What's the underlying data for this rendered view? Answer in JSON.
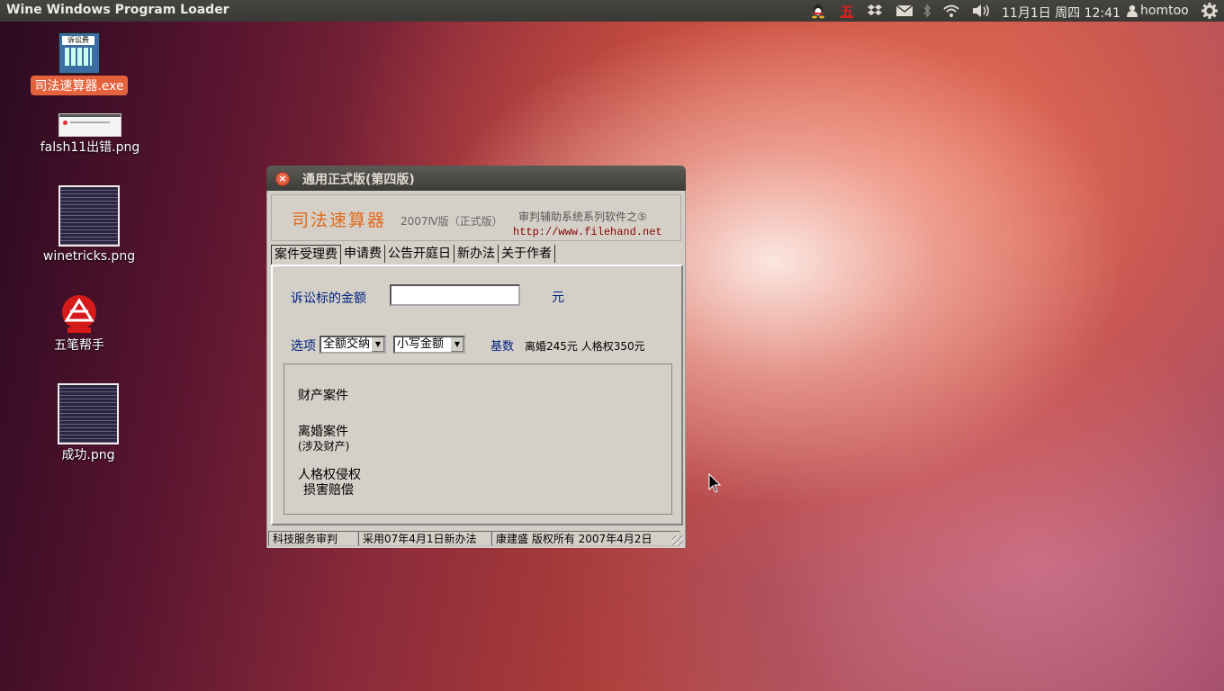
{
  "panel": {
    "app_title": "Wine Windows Program Loader",
    "clock": "11月1日 周四 12:41",
    "user": "homtoo",
    "indicators": [
      "qq-icon",
      "wubi-input-icon",
      "dropbox-icon",
      "mail-icon",
      "bluetooth-icon",
      "wifi-icon",
      "volume-icon"
    ],
    "wubi_glyph": "五"
  },
  "desktop": {
    "icons": [
      {
        "label": "司法速算器.exe",
        "thumb_text": "诉讼费"
      },
      {
        "label": "falsh11出错.png"
      },
      {
        "label": "winetricks.png"
      },
      {
        "label": "五笔帮手"
      },
      {
        "label": "成功.png"
      }
    ]
  },
  "window": {
    "title": "通用正式版(第四版)",
    "close": "×",
    "banner": {
      "logo": "司法速算器",
      "version": "2007Ⅳ版（正式版）",
      "series": "审判辅助系统系列软件之⑤",
      "url": "http://www.filehand.net"
    },
    "tabs": [
      "案件受理费",
      "申请费",
      "公告开庭日",
      "新办法",
      "关于作者"
    ],
    "form": {
      "amount_label": "诉讼标的金额",
      "amount_value": "",
      "amount_unit": "元",
      "options_label": "选项",
      "option1": "全额交纳",
      "option2": "小写金额",
      "base_label": "基数",
      "base_values": "离婚245元  人格权350元"
    },
    "results": {
      "property": "财产案件",
      "divorce": "离婚案件",
      "divorce_note": "(涉及财产)",
      "personality": "人格权侵权",
      "personality2": "损害赔偿"
    },
    "status": [
      "科技服务审判",
      "采用07年4月1日新办法",
      "康建盛  版权所有   2007年4月2日"
    ]
  },
  "colors": {
    "selection": "#e4633d",
    "window_bg": "#d4d0c8",
    "label_blue": "#002080",
    "logo_orange": "#e06a1a"
  }
}
